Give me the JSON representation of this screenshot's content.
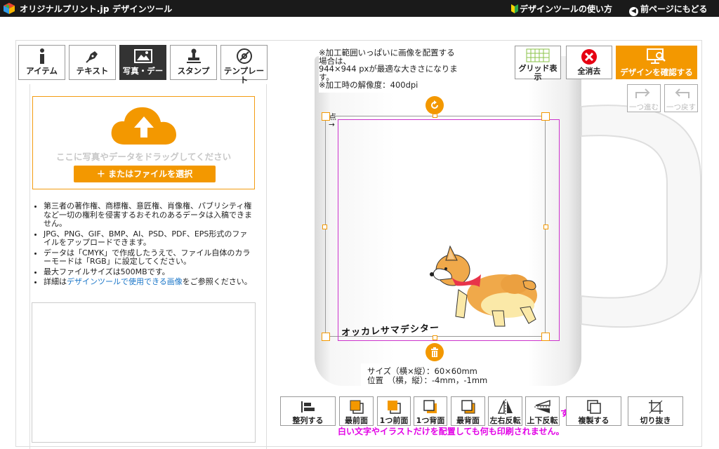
{
  "header": {
    "site_title": "オリジナルプリント.jp デザインツール",
    "help_link": "デザインツールの使い方",
    "back_link": "前ページにもどる"
  },
  "tool_tabs": [
    {
      "label": "アイテム",
      "icon": "info-icon",
      "active": false
    },
    {
      "label": "テキスト",
      "icon": "pen-icon",
      "active": false
    },
    {
      "label": "写真・デー",
      "icon": "image-icon",
      "active": true
    },
    {
      "label": "スタンプ",
      "icon": "stamp-icon",
      "active": false
    },
    {
      "label": "テンプレー",
      "label2": "ト",
      "icon": "template-icon",
      "active": false
    }
  ],
  "upload": {
    "drop_text": "ここに写真やデータをドラッグしてください",
    "file_button": "＋ またはファイルを選択"
  },
  "notes": {
    "item1": "第三者の著作権、商標権、意匠権、肖像権、パブリシティ権など一切の権利を侵害するおそれのあるデータは入稿できません。",
    "item2": "JPG、PNG、GIF、BMP、AI、PSD、PDF、EPS形式のファイルをアップロードできます。",
    "item3": "データは「CMYK」で作成したうえで、ファイル自体のカラーモードは「RGB」に設定してください。",
    "item4": "最大ファイルサイズは500MBです。",
    "item5_prefix": "詳細は",
    "item5_link": "デザインツールで使用できる画像",
    "item5_suffix": "をご参照ください。"
  },
  "info_top": {
    "line1": "※加工範囲いっぱいに画像を配置する",
    "line2": "場合は、",
    "line3": "944×944 pxが最適な大きさになりま",
    "line4": "す。",
    "line5": "※加工時の解像度：400dpi"
  },
  "top_actions": {
    "grid_label": "グリッド表",
    "grid_label2": "示",
    "clear_label": "全消去",
    "confirm_label": "デザインを確認する"
  },
  "history": {
    "redo_label": "一つ進む",
    "undo_label": "一つ戻す"
  },
  "canvas": {
    "origin_label": "原点",
    "origin_arrow": "→",
    "artwork_text": "オッカレサマデシター"
  },
  "info_bottom": {
    "size_line": "サイズ（横×縦）：60×60mm",
    "pos_line": "位置　（横，縦）：-4mm，-1mm"
  },
  "bottom_toolbar": [
    {
      "label": "整列する",
      "icon": "align-icon"
    },
    {
      "label": "最前面",
      "icon": "bring-front-icon"
    },
    {
      "label": "1つ前面",
      "icon": "bring-forward-icon"
    },
    {
      "label": "1つ背面",
      "icon": "send-backward-icon"
    },
    {
      "label": "最背面",
      "icon": "send-back-icon"
    },
    {
      "label": "左右反転",
      "icon": "flip-horizontal-icon"
    },
    {
      "label": "上下反転",
      "icon": "flip-vertical-icon"
    },
    {
      "label": "複製する",
      "icon": "duplicate-icon"
    },
    {
      "label": "切り抜き",
      "icon": "crop-icon"
    }
  ],
  "warning": "白い文字やイラストだけを配置しても何も印刷されません。",
  "warning_fragment": "す",
  "colors": {
    "accent": "#f39800",
    "topbar": "#1a1a1a",
    "warning": "#e200e6",
    "link": "#1a76c8"
  }
}
